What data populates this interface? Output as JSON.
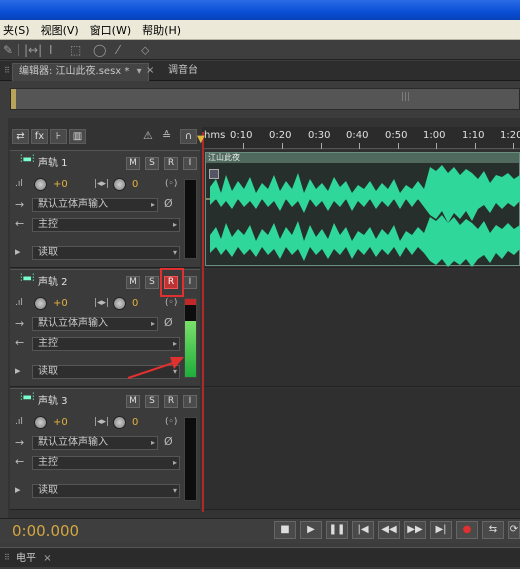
{
  "menu": [
    "夹(S)",
    "视图(V)",
    "窗口(W)",
    "帮助(H)"
  ],
  "toolbar": {
    "icons": [
      "pencil-icon",
      "time-selection-icon",
      "text-cursor-icon",
      "marquee-icon",
      "lasso-icon",
      "brush-icon",
      "healing-icon"
    ]
  },
  "tabs": {
    "editor": "编辑器: 江山此夜.sesx *",
    "mixer": "调音台"
  },
  "ruler": {
    "labels": [
      "hms",
      "0:10",
      "0:20",
      "0:30",
      "0:40",
      "0:50",
      "1:00",
      "1:10",
      "1:20"
    ]
  },
  "clip": {
    "name": "江山此夜"
  },
  "tracks": [
    {
      "name": "声轨 1",
      "m": "M",
      "s": "S",
      "r": "R",
      "i": "I",
      "volume": "+0",
      "pan": "0",
      "input": "默认立体声输入",
      "output": "主控",
      "automation": "读取",
      "armed": false
    },
    {
      "name": "声轨 2",
      "m": "M",
      "s": "S",
      "r": "R",
      "i": "I",
      "volume": "+0",
      "pan": "0",
      "input": "默认立体声输入",
      "output": "主控",
      "automation": "读取",
      "armed": true
    },
    {
      "name": "声轨 3",
      "m": "M",
      "s": "S",
      "r": "R",
      "i": "I",
      "volume": "+0",
      "pan": "0",
      "input": "默认立体声输入",
      "output": "主控",
      "automation": "读取",
      "armed": false
    }
  ],
  "transport": {
    "time": "0:00.000"
  },
  "bottom": {
    "levels_tab": "电平"
  },
  "colors": {
    "accent": "#d4a640",
    "waveform": "#2fd89a",
    "record": "#e0302f"
  }
}
